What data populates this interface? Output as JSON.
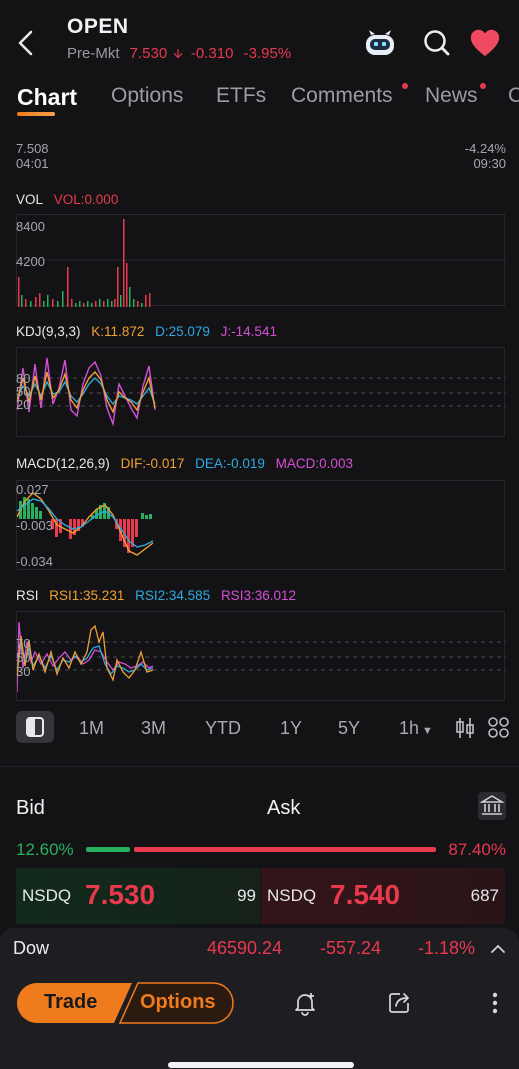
{
  "header": {
    "symbol": "OPEN",
    "session_label": "Pre-Mkt",
    "price": "7.530",
    "change": "-0.310",
    "change_pct": "-3.95%",
    "direction": "down"
  },
  "tabs": [
    {
      "label": "Chart",
      "active": true
    },
    {
      "label": "Options",
      "active": false
    },
    {
      "label": "ETFs",
      "active": false
    },
    {
      "label": "Comments",
      "active": false,
      "badge": true
    },
    {
      "label": "News",
      "active": false,
      "badge": true
    }
  ],
  "price_chart": {
    "low_value": "7.508",
    "start_time": "04:01",
    "low_pct": "-4.24%",
    "end_time": "09:30"
  },
  "vol": {
    "label": "VOL",
    "value": "VOL:0.000",
    "ticks": [
      "8400",
      "4200"
    ]
  },
  "kdj": {
    "label": "KDJ(9,3,3)",
    "k": "K:11.872",
    "d": "D:25.079",
    "j": "J:-14.541",
    "ticks": [
      "80",
      "50",
      "20"
    ]
  },
  "macd": {
    "label": "MACD(12,26,9)",
    "dif": "DIF:-0.017",
    "dea": "DEA:-0.019",
    "macd": "MACD:0.003",
    "ticks": [
      "0.027",
      "-0.003",
      "-0.034"
    ]
  },
  "rsi": {
    "label": "RSI",
    "rsi1": "RSI1:35.231",
    "rsi2": "RSI2:34.585",
    "rsi3": "RSI3:36.012",
    "ticks": [
      "70",
      "50",
      "30"
    ]
  },
  "ranges": [
    "1M",
    "3M",
    "YTD",
    "1Y",
    "5Y",
    "1h"
  ],
  "bidask": {
    "bid_label": "Bid",
    "ask_label": "Ask",
    "bid_pct": "12.60%",
    "ask_pct": "87.40%",
    "bid_share": 0.126,
    "bid_exchange": "NSDQ",
    "bid_price": "7.530",
    "bid_size": "99",
    "ask_exchange": "NSDQ",
    "ask_price": "7.540",
    "ask_size": "687"
  },
  "index_bar": {
    "name": "Dow",
    "value": "46590.24",
    "change": "-557.24",
    "change_pct": "-1.18%"
  },
  "actions": {
    "trade_label": "Trade",
    "options_label": "Options"
  },
  "colors": {
    "down": "#e8394d",
    "up": "#27b05e",
    "accent": "#f07b1c",
    "k_line": "#f0a030",
    "d_line": "#2fa9e0",
    "j_line": "#d44fd6"
  }
}
